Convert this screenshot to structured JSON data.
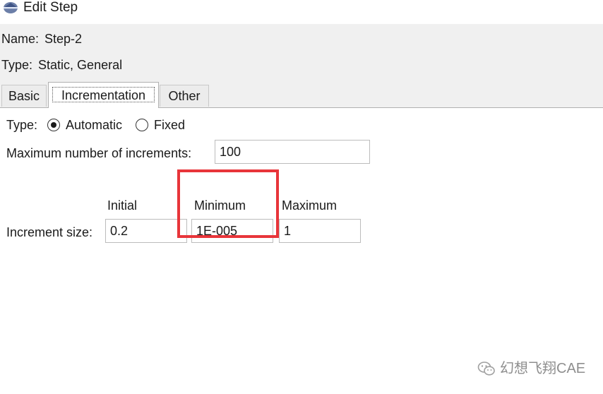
{
  "window": {
    "title": "Edit Step",
    "icon": "step-diamond-icon"
  },
  "step": {
    "name_label": "Name:",
    "name_value": "Step-2",
    "type_label": "Type:",
    "type_value": "Static, General"
  },
  "tabs": [
    {
      "label": "Basic",
      "active": false
    },
    {
      "label": "Incrementation",
      "active": true
    },
    {
      "label": "Other",
      "active": false
    }
  ],
  "incrementation": {
    "type_label": "Type:",
    "options": [
      {
        "label": "Automatic",
        "selected": true
      },
      {
        "label": "Fixed",
        "selected": false
      }
    ],
    "max_increments_label": "Maximum number of increments:",
    "max_increments_value": "100",
    "increment_size_label": "Increment size:",
    "columns": {
      "initial": "Initial",
      "minimum": "Minimum",
      "maximum": "Maximum"
    },
    "values": {
      "initial": "0.2",
      "minimum": "1E-005",
      "maximum": "1"
    }
  },
  "annotation": {
    "highlight_color": "#e8353a"
  },
  "watermark": {
    "text": "幻想飞翔CAE",
    "icon": "wechat-icon"
  }
}
